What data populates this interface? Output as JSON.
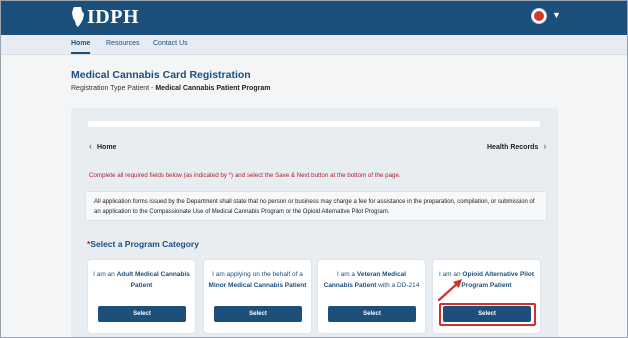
{
  "header": {
    "logo_text": "IDPH",
    "colors": {
      "header_bg": "#1d4f7b",
      "accent_red": "#d0312d"
    },
    "avatar_icon": "user-avatar-icon",
    "menu_caret_icon": "caret-down-icon"
  },
  "nav": {
    "items": [
      {
        "label": "Home"
      },
      {
        "label": "Resources"
      },
      {
        "label": "Contact Us"
      }
    ]
  },
  "page": {
    "title": "Medical Cannabis Card Registration",
    "subtitle_prefix": "Registration Type Patient - ",
    "subtitle_bold": "Medical Cannabis Patient Program"
  },
  "breadcrumb": {
    "back_label": "Home",
    "next_label": "Health Records"
  },
  "required_note": "Complete all required fields below (as indicated by *) and select the Save & Next button at the bottom of the page.",
  "disclaimer": "All application forms issued by the Department shall state that no person or business may charge a fee for assistance in the preparation, compilation, or submission of an application to the Compassionate Use of Medical Cannabis Program or the Opioid Alternative Pilot Program.",
  "section": {
    "required_star": "*",
    "title": "Select a Program Category"
  },
  "options": [
    {
      "pre": "I am an ",
      "bold": "Adult Medical Cannabis Patient",
      "post": "",
      "button": "Select"
    },
    {
      "pre": "I am applying on the behalf of a ",
      "bold": "Minor Medical Cannabis Patient",
      "post": "",
      "button": "Select"
    },
    {
      "pre": "I am a ",
      "bold": "Veteran Medical Cannabis Patient",
      "post": " with a DD-214",
      "button": "Select"
    },
    {
      "pre": "I am an ",
      "bold": "Opioid Alternative Pilot Program Patient",
      "post": "",
      "button": "Select"
    }
  ]
}
